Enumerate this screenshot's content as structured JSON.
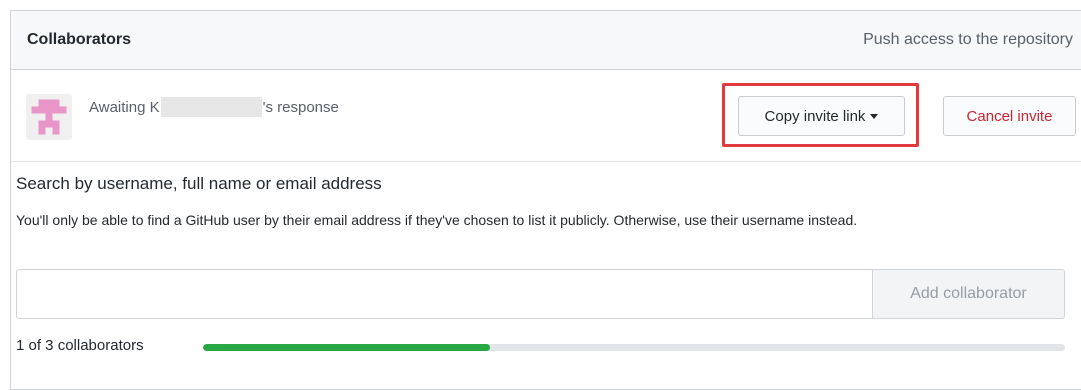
{
  "header": {
    "title": "Collaborators",
    "note": "Push access to the repository"
  },
  "invite": {
    "awaiting_prefix": "Awaiting K",
    "awaiting_suffix": "'s response",
    "copy_label": "Copy invite link",
    "cancel_label": "Cancel invite",
    "avatar_icon": "identicon-avatar",
    "avatar_color": "#e896c8"
  },
  "search": {
    "title": "Search by username, full name or email address",
    "help": "You'll only be able to find a GitHub user by their email address if they've chosen to list it publicly. Otherwise, use their username instead.",
    "input_value": "",
    "input_placeholder": "",
    "add_label": "Add collaborator"
  },
  "collaborators": {
    "count_label": "1 of 3 collaborators",
    "used": 1,
    "total": 3
  },
  "colors": {
    "progress_fill": "#28a745",
    "cancel_text": "#cb2431",
    "highlight": "#e0393e"
  }
}
